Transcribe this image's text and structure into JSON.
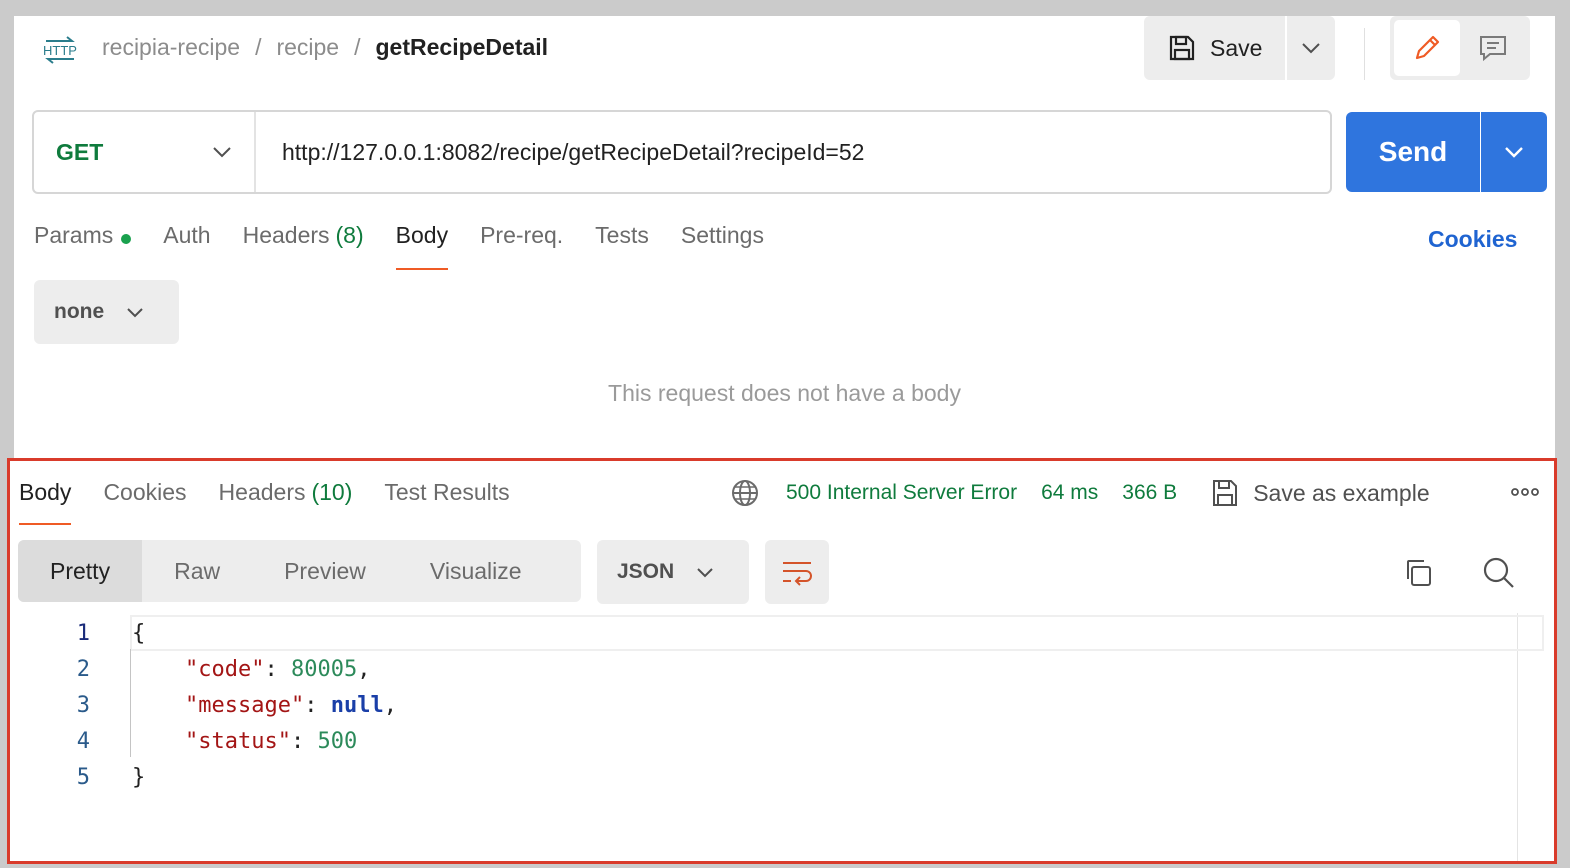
{
  "header": {
    "breadcrumb": [
      "recipia-recipe",
      "recipe"
    ],
    "current": "getRecipeDetail",
    "save_label": "Save",
    "separator": "/"
  },
  "request": {
    "method": "GET",
    "url": "http://127.0.0.1:8082/recipe/getRecipeDetail?recipeId=52",
    "send_label": "Send"
  },
  "request_tabs": {
    "params": "Params",
    "auth": "Auth",
    "headers": "Headers",
    "headers_count": "(8)",
    "body": "Body",
    "prereq": "Pre-req.",
    "tests": "Tests",
    "settings": "Settings",
    "cookies": "Cookies"
  },
  "body_section": {
    "type": "none",
    "empty_message": "This request does not have a body"
  },
  "response": {
    "tabs": {
      "body": "Body",
      "cookies": "Cookies",
      "headers": "Headers",
      "headers_count": "(10)",
      "test_results": "Test Results"
    },
    "status": "500 Internal Server Error",
    "time": "64 ms",
    "size": "366 B",
    "save_example": "Save as example",
    "views": {
      "pretty": "Pretty",
      "raw": "Raw",
      "preview": "Preview",
      "visualize": "Visualize"
    },
    "format": "JSON",
    "line_numbers": [
      "1",
      "2",
      "3",
      "4",
      "5"
    ],
    "json": {
      "open": "{",
      "code_key": "\"code\"",
      "code_value": "80005",
      "message_key": "\"message\"",
      "message_value": "null",
      "status_key": "\"status\"",
      "status_value": "500",
      "close": "}"
    }
  },
  "colors": {
    "accent_orange": "#ef5b25",
    "send_blue": "#2f75de",
    "status_green": "#0f7b3d",
    "highlight_border": "#d93b2b"
  }
}
